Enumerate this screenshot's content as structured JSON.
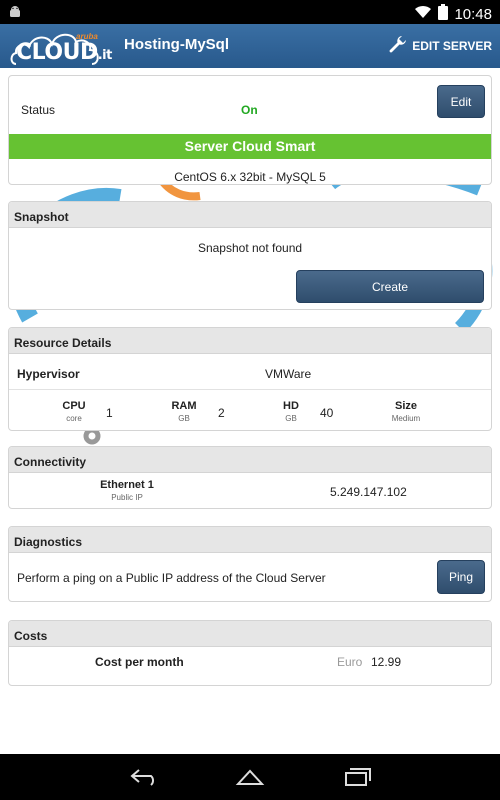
{
  "status_bar": {
    "time": "10:48"
  },
  "header": {
    "logo": {
      "brand": "aruba",
      "name": "CLOUD",
      "suffix": ".it"
    },
    "title": "Hosting-MySql",
    "edit_server_label": "EDIT SERVER"
  },
  "status_card": {
    "label": "Status",
    "value": "On",
    "edit_label": "Edit",
    "plan": "Server Cloud Smart",
    "os": "CentOS 6.x 32bit - MySQL 5"
  },
  "snapshot": {
    "title": "Snapshot",
    "message": "Snapshot not found",
    "create_label": "Create"
  },
  "resources": {
    "title": "Resource Details",
    "hypervisor_label": "Hypervisor",
    "hypervisor_value": "VMWare",
    "cpu": {
      "label": "CPU",
      "unit": "core",
      "value": "1"
    },
    "ram": {
      "label": "RAM",
      "unit": "GB",
      "value": "2"
    },
    "hd": {
      "label": "HD",
      "unit": "GB",
      "value": "40"
    },
    "size": {
      "label": "Size",
      "unit": "Medium"
    }
  },
  "connectivity": {
    "title": "Connectivity",
    "interface_label": "Ethernet 1",
    "interface_sub": "Public IP",
    "ip": "5.249.147.102"
  },
  "diagnostics": {
    "title": "Diagnostics",
    "description": "Perform a ping on a Public IP address of the Cloud Server",
    "ping_label": "Ping"
  },
  "costs": {
    "title": "Costs",
    "label": "Cost per month",
    "currency": "Euro",
    "value": "12.99"
  },
  "colors": {
    "header": "#28598c",
    "status_on": "#22a822",
    "plan_bar": "#66c232",
    "button": "#2f4d6d"
  },
  "icons": {
    "status_bar": [
      "android-icon",
      "wifi-icon",
      "battery-icon"
    ],
    "header": [
      "wrench-icon"
    ],
    "nav": [
      "back-icon",
      "home-icon",
      "recent-apps-icon"
    ]
  }
}
